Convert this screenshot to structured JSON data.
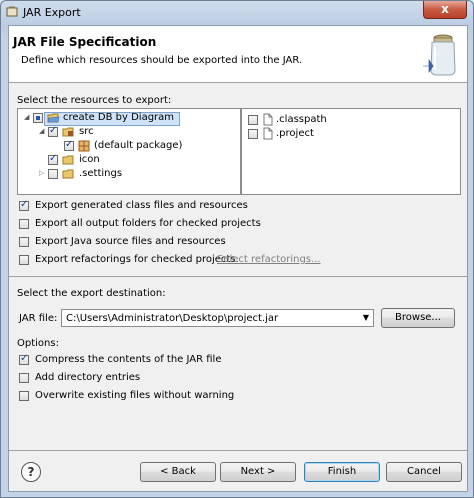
{
  "window": {
    "title": "JAR Export",
    "close_label": "x"
  },
  "header": {
    "title": "JAR File Specification",
    "description": "Define which resources should be exported into the JAR."
  },
  "resources": {
    "label": "Select the resources to export:",
    "tree": [
      {
        "label": "create DB by Diagram",
        "state": "partial",
        "expanded": true
      },
      {
        "label": "src",
        "state": "checked",
        "expanded": true
      },
      {
        "label": "(default package)",
        "state": "checked"
      },
      {
        "label": "icon",
        "state": "checked"
      },
      {
        "label": ".settings",
        "state": "unchecked",
        "expanded": false
      }
    ],
    "files": [
      {
        "label": ".classpath",
        "state": "unchecked"
      },
      {
        "label": ".project",
        "state": "unchecked"
      }
    ]
  },
  "export_options": [
    {
      "label": "Export generated class files and resources",
      "checked": true
    },
    {
      "label": "Export all output folders for checked projects",
      "checked": false
    },
    {
      "label": "Export Java source files and resources",
      "checked": false
    },
    {
      "label": "Export refactorings for checked projects.",
      "checked": false
    }
  ],
  "select_refactorings_link": "Select refactorings...",
  "destination": {
    "label": "Select the export destination:",
    "jar_file_label": "JAR file:",
    "jar_file_value": "C:\\Users\\Administrator\\Desktop\\project.jar",
    "browse_label": "Browse..."
  },
  "options": {
    "label": "Options:",
    "items": [
      {
        "label": "Compress the contents of the JAR file",
        "checked": true
      },
      {
        "label": "Add directory entries",
        "checked": false
      },
      {
        "label": "Overwrite existing files without warning",
        "checked": false
      }
    ]
  },
  "buttons": {
    "help": "?",
    "back": "< Back",
    "next": "Next >",
    "finish": "Finish",
    "cancel": "Cancel"
  }
}
